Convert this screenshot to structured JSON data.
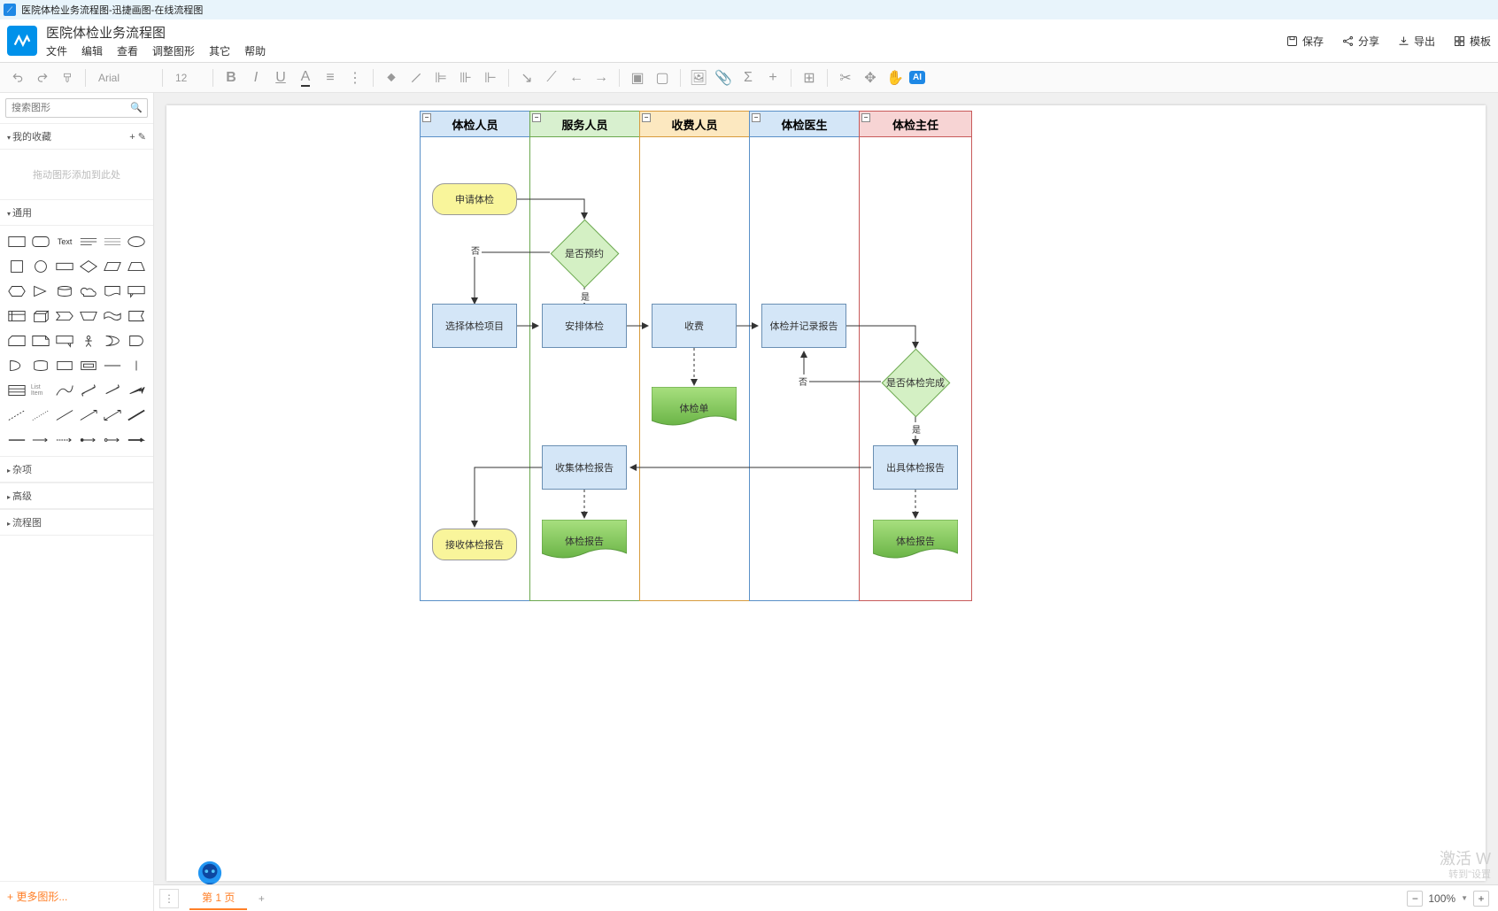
{
  "titlebar": "医院体检业务流程图-迅捷画图-在线流程图",
  "doc_title": "医院体检业务流程图",
  "menu": {
    "file": "文件",
    "edit": "编辑",
    "view": "查看",
    "adjust": "调整图形",
    "other": "其它",
    "help": "帮助"
  },
  "actions": {
    "save": "保存",
    "share": "分享",
    "export": "导出",
    "templates": "模板"
  },
  "toolbar": {
    "font": "Arial",
    "size": "12",
    "ai": "AI"
  },
  "sidebar": {
    "search_placeholder": "搜索图形",
    "favorites": "我的收藏",
    "fav_placeholder": "拖动图形添加到此处",
    "general": "通用",
    "misc": "杂项",
    "advanced": "高级",
    "flowchart": "流程图",
    "more_shapes": "+ 更多图形..."
  },
  "swimlanes": [
    {
      "title": "体检人员",
      "color_head": "#d4e6f7",
      "color_border": "#5a90c8"
    },
    {
      "title": "服务人员",
      "color_head": "#d8f0cf",
      "color_border": "#6ba84f"
    },
    {
      "title": "收费人员",
      "color_head": "#fce8c0",
      "color_border": "#d79b3d"
    },
    {
      "title": "体检医生",
      "color_head": "#d4e6f7",
      "color_border": "#5a90c8"
    },
    {
      "title": "体检主任",
      "color_head": "#f7d4d4",
      "color_border": "#c85a5a"
    }
  ],
  "nodes": {
    "start": "申请体检",
    "decision1": "是否预约",
    "decision1_no": "否",
    "decision1_yes": "是",
    "select_items": "选择体检项目",
    "arrange": "安排体检",
    "charge": "收费",
    "exam_record": "体检并记录报告",
    "checkup_sheet": "体检单",
    "decision2": "是否体检完成",
    "decision2_no": "否",
    "decision2_yes": "是",
    "issue_report": "出具体检报告",
    "collect_report": "收集体检报告",
    "report_doc1": "体检报告",
    "report_doc2": "体检报告",
    "receive_report": "接收体检报告"
  },
  "statusbar": {
    "page1": "第 1 页",
    "zoom": "100%"
  },
  "watermark": {
    "big": "激活 W",
    "small": "转到\"设置"
  }
}
